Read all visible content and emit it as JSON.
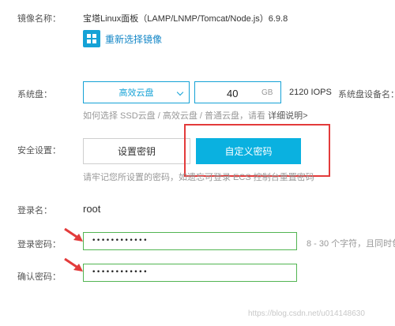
{
  "image": {
    "label": "镜像名称：",
    "name": "宝塔Linux面板（LAMP/LNMP/Tomcat/Node.js）6.9.8",
    "reselect_label": "重新选择镜像"
  },
  "disk": {
    "label": "系统盘：",
    "type_selected": "高效云盘",
    "size_value": "40",
    "size_unit": "GB",
    "iops": "2120 IOPS",
    "device_label": "系统盘设备名：/",
    "help_text": "如何选择 SSD云盘 / 高效云盘 / 普通云盘，请看",
    "help_link": "详细说明>"
  },
  "security": {
    "label": "安全设置：",
    "btn_set_key": "设置密钥",
    "btn_custom_password": "自定义密码",
    "note": "请牢记您所设置的密码，如遗忘可登录 ECS 控制台重置密码"
  },
  "login": {
    "user_label": "登录名：",
    "user_value": "root",
    "password_label": "登录密码：",
    "password_value": "••••••••••••",
    "password_hint": "8 - 30 个字符，且同时包",
    "confirm_label": "确认密码：",
    "confirm_value": "••••••••••••"
  },
  "watermark": "https://blog.csdn.net/u014148630",
  "colors": {
    "primary": "#0ab1e0",
    "link": "#1487c7",
    "highlight_red": "#e33b3b",
    "valid_green": "#52b552"
  }
}
